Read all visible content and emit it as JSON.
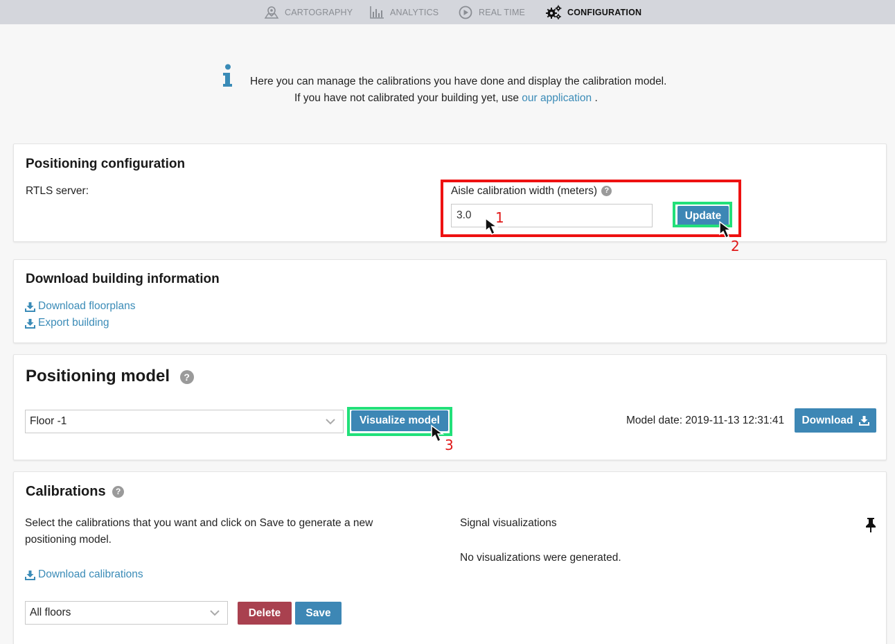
{
  "nav": {
    "cartography": "CARTOGRAPHY",
    "analytics": "ANALYTICS",
    "realtime": "REAL TIME",
    "configuration": "CONFIGURATION"
  },
  "info": {
    "line1": "Here you can manage the calibrations you have done and display the calibration model.",
    "line2_prefix": "If you have not calibrated your building yet, use",
    "line2_link": "our application",
    "line2_suffix": "."
  },
  "positioning_config": {
    "title": "Positioning configuration",
    "rtls_label": "RTLS server:",
    "aisle_label": "Aisle calibration width (meters)",
    "aisle_value": "3.0",
    "update_label": "Update"
  },
  "download_building": {
    "title": "Download building information",
    "floorplans": "Download floorplans",
    "export": "Export building"
  },
  "positioning_model": {
    "title": "Positioning model",
    "floor_select": "Floor -1",
    "visualize_label": "Visualize model",
    "model_date": "Model date: 2019-11-13 12:31:41",
    "download_label": "Download"
  },
  "calibrations": {
    "title": "Calibrations",
    "description_line1": "Select the calibrations that you want and click on Save to generate a new",
    "description_line2": "positioning model.",
    "download_calibrations": "Download calibrations",
    "floors_select": "All floors",
    "delete_label": "Delete",
    "save_label": "Save",
    "signal_title": "Signal visualizations",
    "no_visualizations": "No visualizations were generated."
  },
  "annotations": {
    "step1": "1",
    "step2": "2",
    "step3": "3"
  },
  "colors": {
    "accent_blue": "#3d87b5",
    "link_blue": "#3a8bb7",
    "delete_red": "#a9414f",
    "annotation_red": "#ee1111",
    "annotation_green": "#22e07a"
  }
}
